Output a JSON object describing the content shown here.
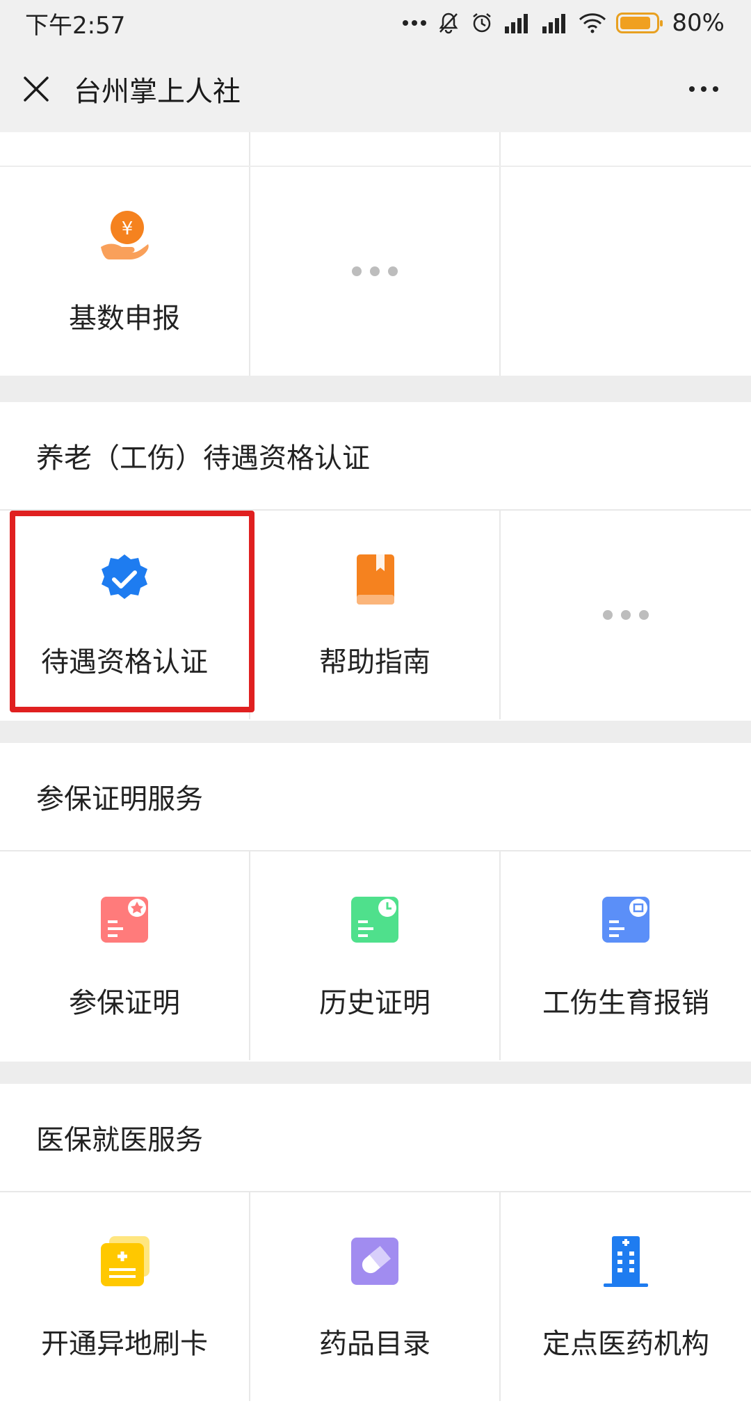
{
  "status_bar": {
    "time": "下午2:57",
    "battery": "80%"
  },
  "title_bar": {
    "title": "台州掌上人社"
  },
  "sections": [
    {
      "header": "",
      "items": [
        {
          "label": "基数申报",
          "icon": "yuan-hand-icon"
        },
        {
          "label": "",
          "icon": "more-dots-icon"
        },
        {
          "label": "",
          "icon": ""
        }
      ]
    },
    {
      "header": "养老（工伤）待遇资格认证",
      "items": [
        {
          "label": "待遇资格认证",
          "icon": "verified-badge-icon"
        },
        {
          "label": "帮助指南",
          "icon": "book-icon"
        },
        {
          "label": "",
          "icon": "more-dots-icon"
        }
      ]
    },
    {
      "header": "参保证明服务",
      "items": [
        {
          "label": "参保证明",
          "icon": "certificate-star-icon"
        },
        {
          "label": "历史证明",
          "icon": "certificate-clock-icon"
        },
        {
          "label": "工伤生育报销",
          "icon": "certificate-zheng-icon"
        }
      ]
    },
    {
      "header": "医保就医服务",
      "items": [
        {
          "label": "开通异地刷卡",
          "icon": "medical-card-icon"
        },
        {
          "label": "药品目录",
          "icon": "pill-icon"
        },
        {
          "label": "定点医药机构",
          "icon": "hospital-building-icon"
        }
      ]
    }
  ],
  "colors": {
    "highlight": "#e02020",
    "verify_blue": "#1e7cf0",
    "orange": "#f5821f"
  }
}
